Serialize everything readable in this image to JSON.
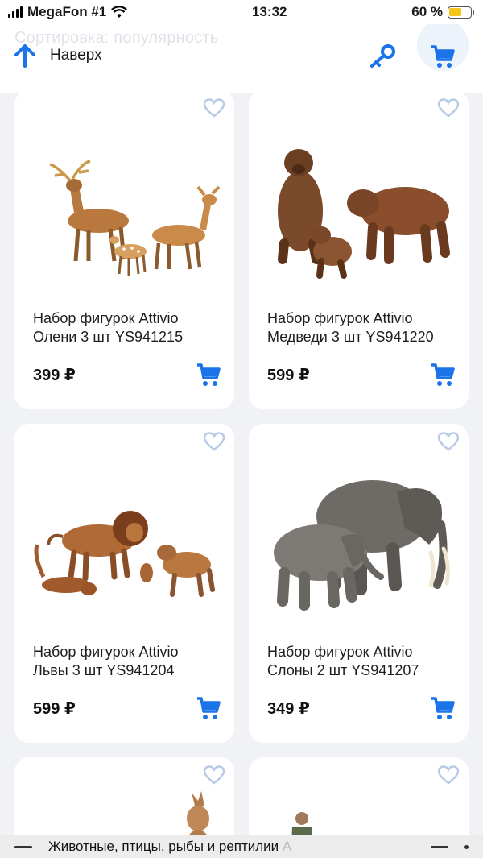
{
  "status_bar": {
    "carrier": "MegaFon #1",
    "time": "13:32",
    "battery": "60 %",
    "battery_level": 0.6
  },
  "header": {
    "sort_hint": "Сортировка: популярность",
    "up_label": "Наверх",
    "up_icon": "arrow-up-icon",
    "key_icon": "key-icon",
    "cart_icon": "cart-icon"
  },
  "products": [
    {
      "title_line1": "Набор фигурок Attivio",
      "title_line2": "Олени 3 шт YS941215",
      "price": "399 ₽",
      "image": "deer-figurines"
    },
    {
      "title_line1": "Набор фигурок Attivio",
      "title_line2": "Медведи 3 шт YS941220",
      "price": "599 ₽",
      "image": "bear-figurines"
    },
    {
      "title_line1": "Набор фигурок Attivio",
      "title_line2": "Львы 3 шт YS941204",
      "price": "599 ₽",
      "image": "lion-figurines"
    },
    {
      "title_line1": "Набор фигурок Attivio",
      "title_line2": "Слоны 2 шт YS941207",
      "price": "349 ₽",
      "image": "elephant-figurines"
    }
  ],
  "bottom_bar": {
    "title": "Животные, птицы, рыбы и рептилии",
    "title_fade": " А"
  },
  "colors": {
    "accent": "#1a73e8",
    "heart": "#b8cbe6"
  }
}
